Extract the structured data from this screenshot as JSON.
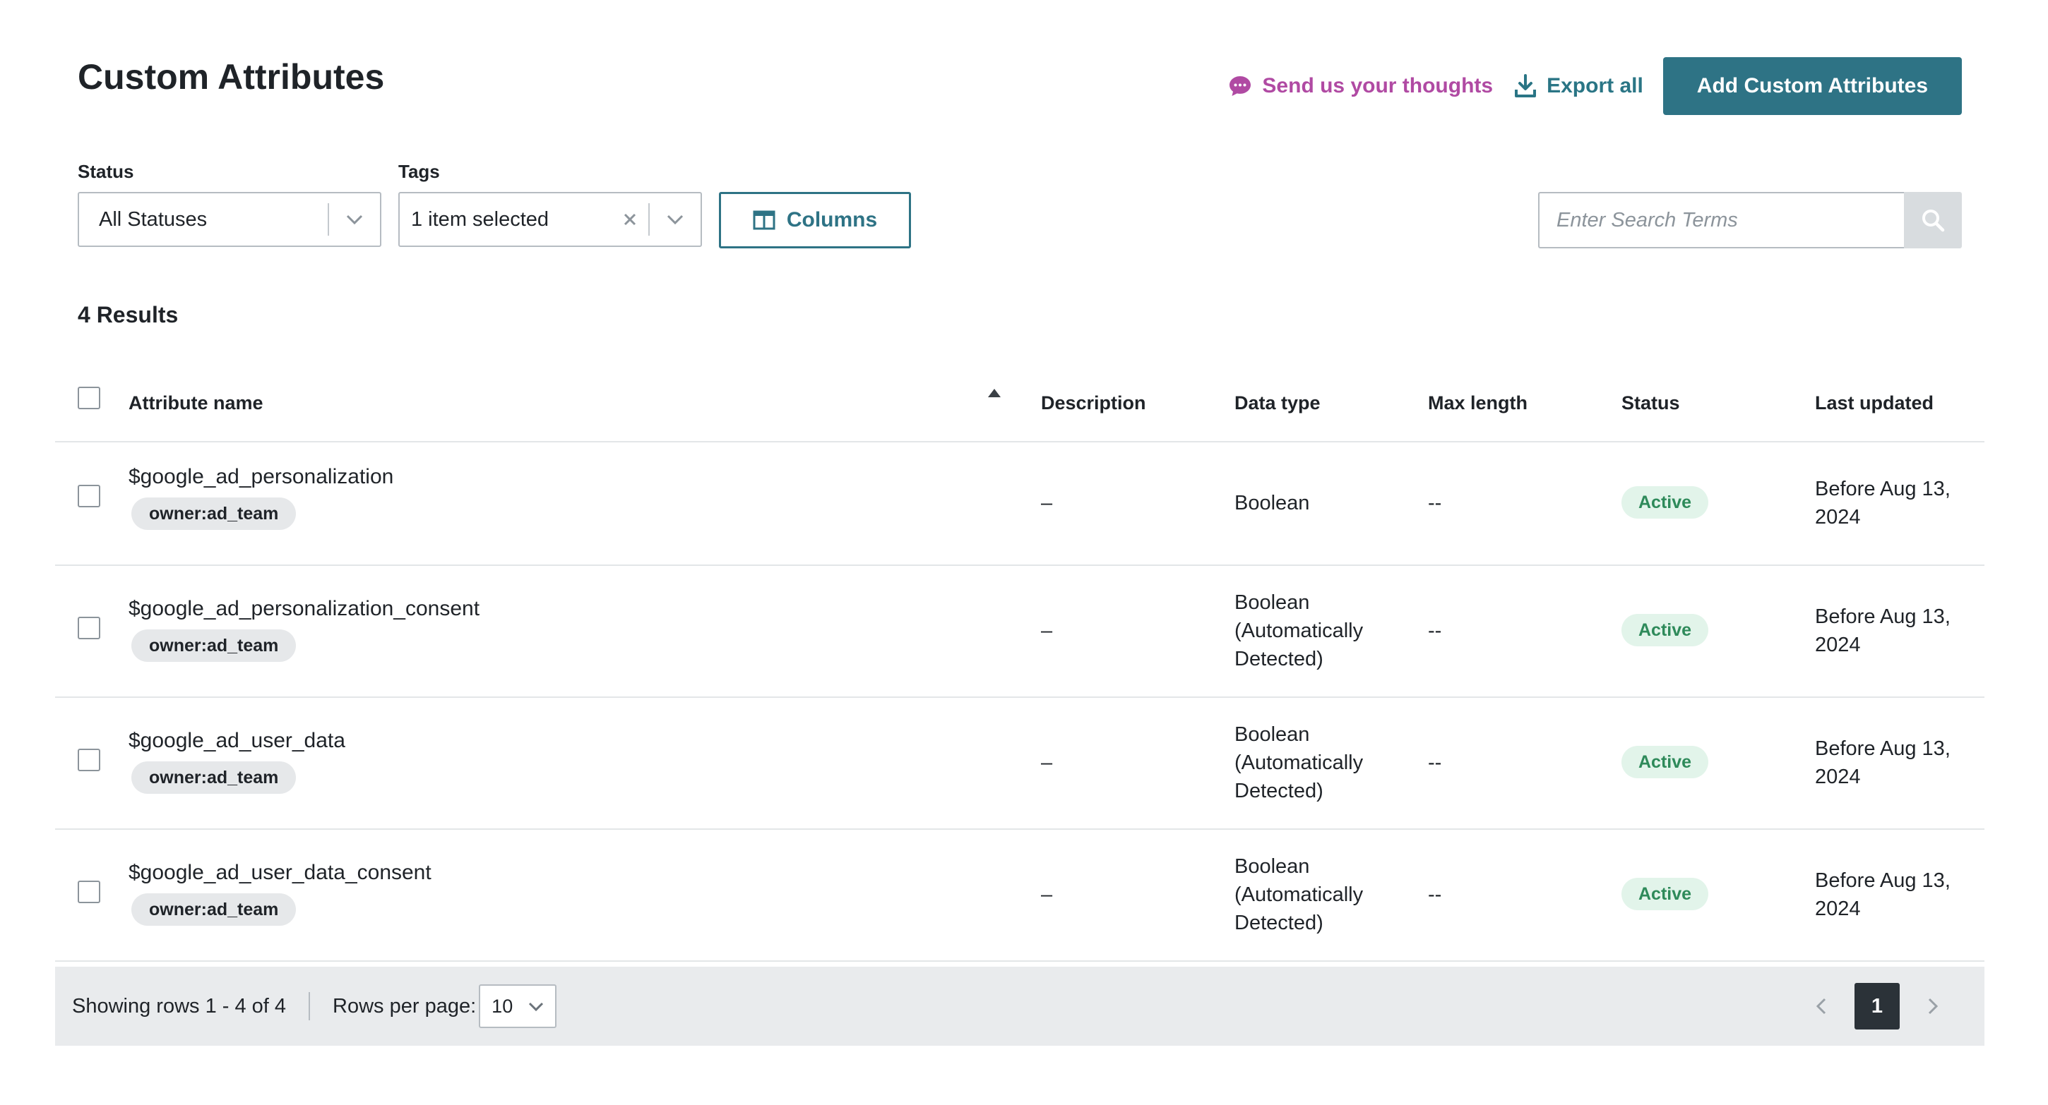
{
  "header": {
    "title": "Custom Attributes",
    "feedback_label": "Send us your thoughts",
    "export_label": "Export all",
    "add_label": "Add Custom Attributes"
  },
  "filters": {
    "status_label": "Status",
    "status_value": "All Statuses",
    "tags_label": "Tags",
    "tags_value": "1 item selected",
    "columns_label": "Columns",
    "search_placeholder": "Enter Search Terms"
  },
  "results": {
    "count_label": "4 Results"
  },
  "table": {
    "columns": {
      "name": "Attribute name",
      "description": "Description",
      "data_type": "Data type",
      "max_length": "Max length",
      "status": "Status",
      "last_updated": "Last updated"
    },
    "rows": [
      {
        "name": "$google_ad_personalization",
        "tag": "owner:ad_team",
        "description": "–",
        "data_type_lines": [
          "Boolean"
        ],
        "max_length": "--",
        "status": "Active",
        "updated_lines": [
          "Before Aug 13,",
          "2024"
        ]
      },
      {
        "name": "$google_ad_personalization_consent",
        "tag": "owner:ad_team",
        "description": "–",
        "data_type_lines": [
          "Boolean",
          "(Automatically",
          "Detected)"
        ],
        "max_length": "--",
        "status": "Active",
        "updated_lines": [
          "Before Aug 13,",
          "2024"
        ]
      },
      {
        "name": "$google_ad_user_data",
        "tag": "owner:ad_team",
        "description": "–",
        "data_type_lines": [
          "Boolean",
          "(Automatically",
          "Detected)"
        ],
        "max_length": "--",
        "status": "Active",
        "updated_lines": [
          "Before Aug 13,",
          "2024"
        ]
      },
      {
        "name": "$google_ad_user_data_consent",
        "tag": "owner:ad_team",
        "description": "–",
        "data_type_lines": [
          "Boolean",
          "(Automatically",
          "Detected)"
        ],
        "max_length": "--",
        "status": "Active",
        "updated_lines": [
          "Before Aug 13,",
          "2024"
        ]
      }
    ]
  },
  "footer": {
    "showing": "Showing rows 1 - 4 of 4",
    "rows_per_page_label": "Rows per page:",
    "rows_per_page_value": "10",
    "current_page": "1"
  },
  "colors": {
    "primary": "#2e7385",
    "feedback": "#b04aa3",
    "active_badge_bg": "#e2f4ea",
    "active_badge_text": "#2e8a5a"
  },
  "icons": {
    "feedback": "speech-bubble-icon",
    "export": "download-icon",
    "columns": "columns-icon",
    "search": "search-icon",
    "sort": "sort-ascending-icon"
  }
}
